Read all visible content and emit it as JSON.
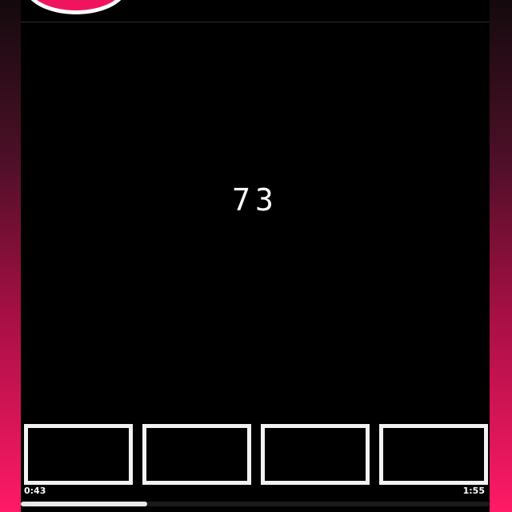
{
  "display": {
    "counter": "73"
  },
  "record_button": {
    "icon": "record-icon",
    "ring_color": "#ffffff",
    "fill_color": "#f0145e"
  },
  "filmstrip": {
    "frames": 4
  },
  "playback": {
    "elapsed": "0:43",
    "total": "1:55",
    "progress_fraction": 0.27
  },
  "colors": {
    "accent": "#ff1a66",
    "background": "#000000"
  }
}
